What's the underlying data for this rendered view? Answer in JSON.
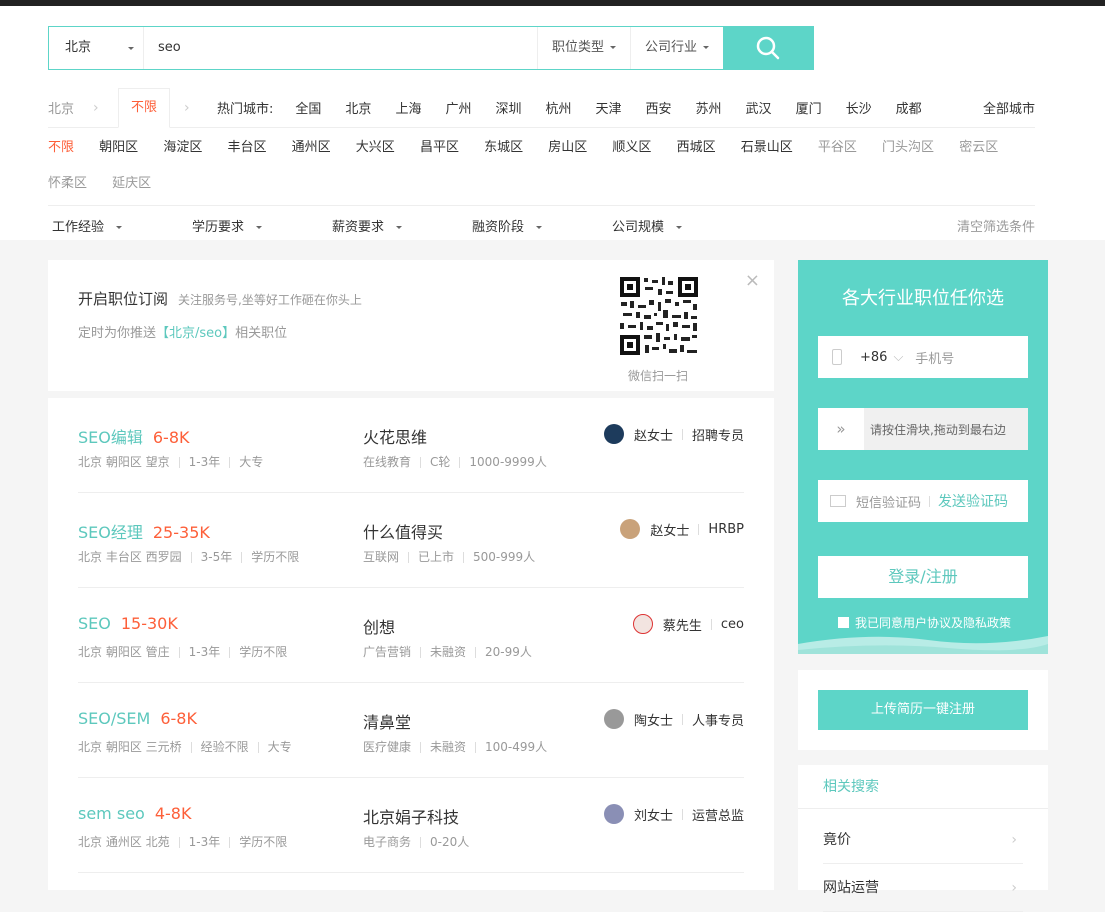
{
  "search": {
    "city": "北京",
    "keyword": "seo",
    "job_type": "职位类型",
    "industry": "公司行业"
  },
  "city_row": {
    "crumb": "北京",
    "unlimited": "不限",
    "hot_label": "热门城市:",
    "hot_cities": [
      "全国",
      "北京",
      "上海",
      "广州",
      "深圳",
      "杭州",
      "天津",
      "西安",
      "苏州",
      "武汉",
      "厦门",
      "长沙",
      "成都"
    ],
    "all_cities": "全部城市"
  },
  "districts": {
    "active": "不限",
    "items": [
      "朝阳区",
      "海淀区",
      "丰台区",
      "通州区",
      "大兴区",
      "昌平区",
      "东城区",
      "房山区",
      "顺义区",
      "西城区",
      "石景山区"
    ],
    "grey_items": [
      "平谷区",
      "门头沟区",
      "密云区",
      "怀柔区"
    ],
    "last": "延庆区"
  },
  "filters": {
    "items": [
      "工作经验",
      "学历要求",
      "薪资要求",
      "融资阶段",
      "公司规模"
    ],
    "clear": "清空筛选条件"
  },
  "subscribe": {
    "title": "开启职位订阅",
    "desc": "关注服务号,坐等好工作砸在你头上",
    "line_prefix": "定时为你推送",
    "highlight": "【北京/seo】",
    "line_suffix": "相关职位",
    "qr_label": "微信扫一扫"
  },
  "jobs": [
    {
      "title": "SEO编辑",
      "salary": "6-8K",
      "location": "北京 朝阳区 望京",
      "exp": "1-3年",
      "edu": "大专",
      "company": "火花思维",
      "industry": "在线教育",
      "stage": "C轮",
      "size": "1000-9999人",
      "hr_name": "赵女士",
      "hr_role": "招聘专员"
    },
    {
      "title": "SEO经理",
      "salary": "25-35K",
      "location": "北京 丰台区 西罗园",
      "exp": "3-5年",
      "edu": "学历不限",
      "company": "什么值得买",
      "industry": "互联网",
      "stage": "已上市",
      "size": "500-999人",
      "hr_name": "赵女士",
      "hr_role": "HRBP"
    },
    {
      "title": "SEO",
      "salary": "15-30K",
      "location": "北京 朝阳区 管庄",
      "exp": "1-3年",
      "edu": "学历不限",
      "company": "创想",
      "industry": "广告营销",
      "stage": "未融资",
      "size": "20-99人",
      "hr_name": "蔡先生",
      "hr_role": "ceo"
    },
    {
      "title": "SEO/SEM",
      "salary": "6-8K",
      "location": "北京 朝阳区 三元桥",
      "exp": "经验不限",
      "edu": "大专",
      "company": "清鼻堂",
      "industry": "医疗健康",
      "stage": "未融资",
      "size": "100-499人",
      "hr_name": "陶女士",
      "hr_role": "人事专员"
    },
    {
      "title": "sem seo",
      "salary": "4-8K",
      "location": "北京 通州区 北苑",
      "exp": "1-3年",
      "edu": "学历不限",
      "company": "北京娟子科技",
      "industry": "电子商务",
      "stage": "0-20人",
      "size": "",
      "hr_name": "刘女士",
      "hr_role": "运营总监"
    }
  ],
  "login": {
    "title": "各大行业职位任你选",
    "country_code": "+86",
    "phone_placeholder": "手机号",
    "slider_text": "请按住滑块,拖动到最右边",
    "sms_placeholder": "短信验证码",
    "send_code": "发送验证码",
    "submit": "登录/注册",
    "agree": "我已同意用户协议及隐私政策"
  },
  "upload": {
    "label": "上传简历一键注册"
  },
  "related": {
    "title": "相关搜索",
    "items": [
      "竟价",
      "网站运营"
    ]
  },
  "colors": {
    "accent": "#5dd5c8",
    "salary": "#fd5f39"
  }
}
